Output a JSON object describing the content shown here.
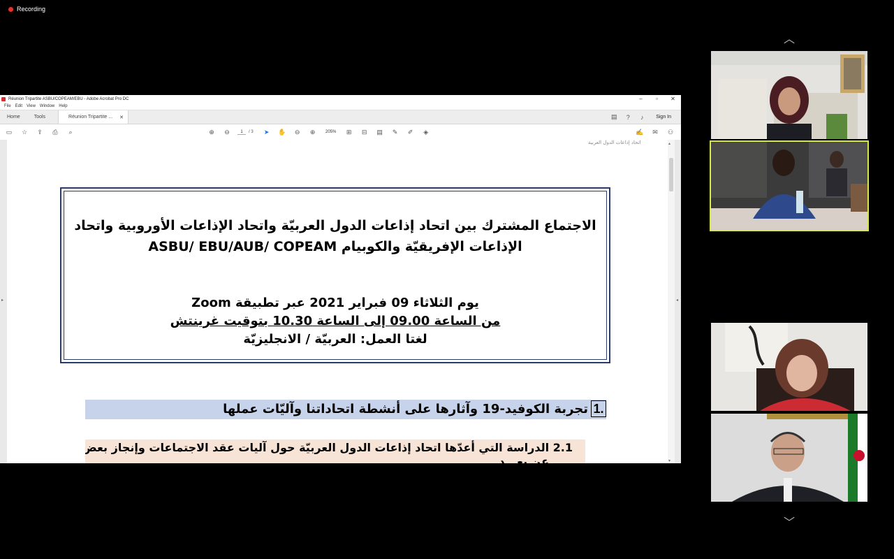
{
  "recording": {
    "label": "Recording"
  },
  "acrobat": {
    "window_title": "Réunion Tripartite ASBU/COPEAM/EBU - Adobe Acrobat Pro DC",
    "menu": [
      "File",
      "Edit",
      "View",
      "Window",
      "Help"
    ],
    "tabs": {
      "home": "Home",
      "tools": "Tools",
      "document": "Réunion Tripartite ...",
      "sign_in": "Sign In"
    },
    "page": {
      "current": "1",
      "total": "/ 3"
    },
    "zoom": "205%"
  },
  "document": {
    "logo_text": "ﺍﺗﺤﺎﺩ ﺇﺫﺍﻋﺎﺕ ﺍﻟﺪﻭﻝ ﺍﻟﻌﺮﺑﻴﺔ",
    "title_line1": "الاجتماع المشترك بين اتحاد إذاعات الدول العربيّة واتحاد الإذاعات الأوروبية واتحاد",
    "title_line2": "الإذاعات الإفريقيّة والكوبيام ASBU/ EBU/AUB/ COPEAM",
    "date_line": "يوم الثلاثاء  09 فبراير 2021 عبر تطبيقة  Zoom",
    "time_line": "من الساعة 09.00 إلى الساعة 10.30 بتوقيت غرينتش",
    "lang_line": "لغتا العمل: العربيّة /  الانجليزيّة",
    "item1_num": "1.",
    "item1_text": "تجربة الكوفيد-19 وآثارها على أنشطة اتحاداتنا وآليّات  عملها",
    "item2_text": "2.1 الدراسة التي أعدّها اتحاد إذاعات الدول العربيّة حول آليات عقد الاجتماعات وإنجاز بعض الدورات التدريبية",
    "item2_text_cont": "عن بعـــد"
  },
  "video_panel": {
    "participants": [
      "participant-1",
      "participant-2",
      "participant-3",
      "participant-4",
      "participant-5"
    ],
    "active_speaker": "participant-2",
    "colors": {
      "active_border": "#d8e84a",
      "record_dot": "#e8312f"
    }
  }
}
